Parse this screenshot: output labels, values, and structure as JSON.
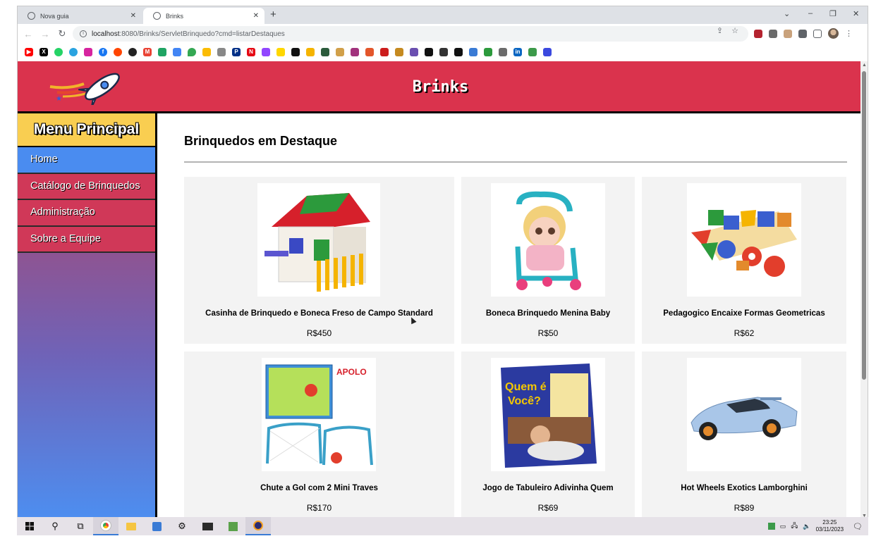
{
  "browser": {
    "tabs": [
      {
        "title": "Nova guia",
        "active": false
      },
      {
        "title": "Brinks",
        "active": true
      }
    ],
    "url_host": "localhost",
    "url_path": ":8080/Brinks/ServletBrinquedo?cmd=listarDestaques"
  },
  "site": {
    "brand": "Brinks",
    "menu_title": "Menu Principal",
    "menu": [
      {
        "label": "Home"
      },
      {
        "label": "Catálogo de Brinquedos"
      },
      {
        "label": "Administração"
      },
      {
        "label": "Sobre a Equipe"
      }
    ],
    "section_title": "Brinquedos em Destaque",
    "products": [
      {
        "name": "Casinha de Brinquedo e Boneca Freso de Campo Standard",
        "price": "R$450"
      },
      {
        "name": "Boneca Brinquedo Menina Baby",
        "price": "R$50"
      },
      {
        "name": "Pedagogico Encaixe Formas Geometricas",
        "price": "R$62"
      },
      {
        "name": "Chute a Gol com 2 Mini Traves",
        "price": "R$170"
      },
      {
        "name": "Jogo de Tabuleiro Adivinha Quem",
        "price": "R$69"
      },
      {
        "name": "Hot Wheels Exotics Lamborghini",
        "price": "R$89"
      }
    ]
  },
  "taskbar": {
    "time": "23:25",
    "date": "03/11/2023"
  }
}
